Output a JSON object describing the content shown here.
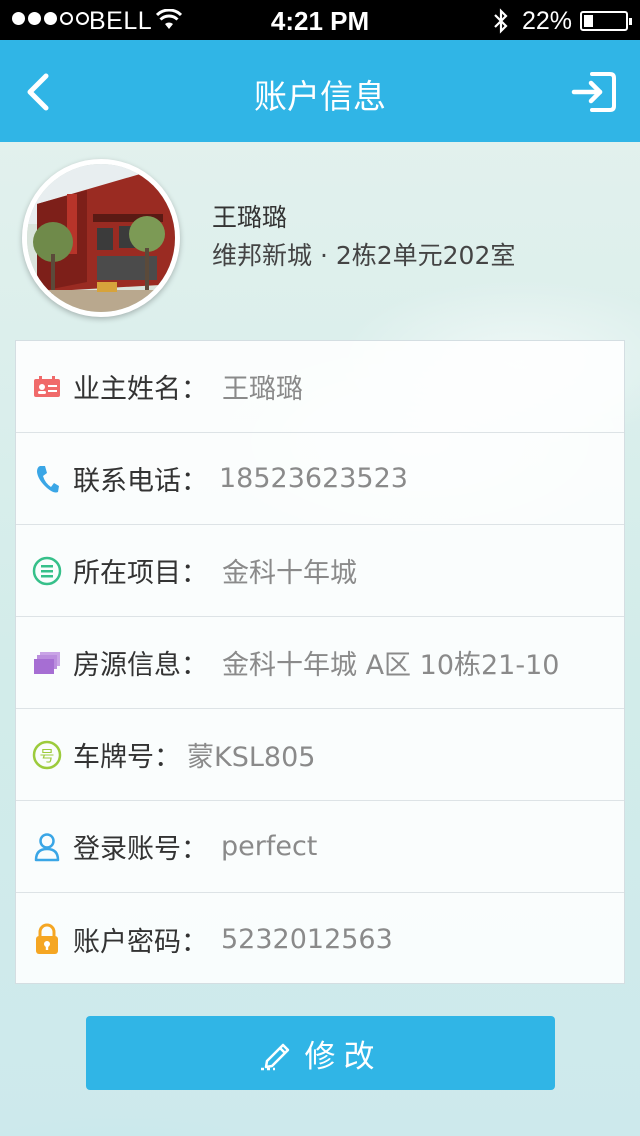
{
  "status_bar": {
    "carrier": "BELL",
    "time": "4:21 PM",
    "battery": "22%",
    "battery_level": 0.22,
    "signal_bars_filled": 3,
    "signal_bars_total": 5
  },
  "nav": {
    "title": "账户信息",
    "back_icon": "chevron-left-icon",
    "logout_icon": "logout-icon"
  },
  "profile": {
    "name": "王璐璐",
    "address": "维邦新城 · 2栋2单元202室"
  },
  "info_rows": [
    {
      "icon": "id-card-icon",
      "icon_color": "#f06a6a",
      "label": "业主姓名：",
      "value": "王璐璐"
    },
    {
      "icon": "phone-icon",
      "icon_color": "#3aa6e6",
      "label": "联系电话：",
      "value": "18523623523"
    },
    {
      "icon": "list-icon",
      "icon_color": "#36c08a",
      "label": "所在项目：",
      "value": "金科十年城"
    },
    {
      "icon": "house-stack-icon",
      "icon_color": "#b47fd9",
      "label": "房源信息：",
      "value": "金科十年城 A区 10栋21-10"
    },
    {
      "icon": "number-icon",
      "icon_color": "#9ccb3c",
      "label": "车牌号：",
      "value": "蒙KSL805"
    },
    {
      "icon": "user-icon",
      "icon_color": "#3aa6e6",
      "label": "登录账号：",
      "value": "perfect"
    },
    {
      "icon": "lock-icon",
      "icon_color": "#f5a623",
      "label": "账户密码：",
      "value": "5232012563"
    }
  ],
  "edit_button": {
    "label": "修改",
    "icon": "pencil-icon"
  },
  "colors": {
    "accent": "#30b5e6",
    "label_text": "#333333",
    "value_text": "#8a8a8a"
  }
}
